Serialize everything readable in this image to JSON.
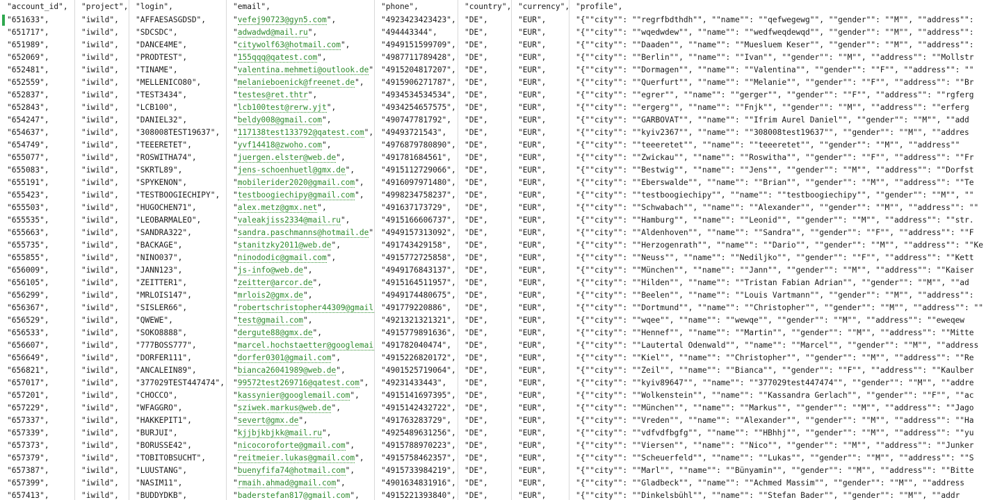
{
  "header": [
    "\"account_id\",",
    "\"project\",",
    "\"login\",",
    "\"email\",",
    "\"phone\",",
    "\"country\",",
    "\"currency\",",
    "\"profile\","
  ],
  "rows": [
    [
      "\"651633\",",
      "\"iwild\",",
      "\"AFFAESASGDSD\",",
      "vefej90723@gyn5.com",
      "\"4923423423423\",",
      "\"DE\",",
      "\"EUR\",",
      "\"{\"\"city\"\": \"\"regrfbdthdh\"\", \"\"name\"\": \"\"qefwegewg\"\", \"\"gender\"\": \"\"M\"\", \"\"address\"\":"
    ],
    [
      "\"651717\",",
      "\"iwild\",",
      "\"SDCSDC\",",
      "adwadwd@mail.ru",
      "\"494443344\",",
      "\"DE\",",
      "\"EUR\",",
      "\"{\"\"city\"\": \"\"wqedwdew\"\", \"\"name\"\": \"\"wedfweqdewqd\"\", \"\"gender\"\": \"\"M\"\", \"\"address\"\":"
    ],
    [
      "\"651989\",",
      "\"iwild\",",
      "\"DANCE4ME\",",
      "citywolf63@hotmail.com",
      "\"4949151599709\",",
      "\"DE\",",
      "\"EUR\",",
      "\"{\"\"city\"\": \"\"Daaden\"\", \"\"name\"\": \"\"Muesluem Keser\"\", \"\"gender\"\": \"\"M\"\", \"\"address\"\":"
    ],
    [
      "\"652069\",",
      "\"iwild\",",
      "\"PRODTEST\",",
      "155qqq@qatest.com",
      "\"4987711789428\",",
      "\"DE\",",
      "\"EUR\",",
      "\"{\"\"city\"\": \"\"Berlin\"\", \"\"name\"\": \"\"Ivan\"\", \"\"gender\"\": \"\"M\"\", \"\"address\"\": \"\"Mollstr"
    ],
    [
      "\"652481\",",
      "\"iwild\",",
      "\"TINAME\",",
      "valentina.mehmeti@outlook.de",
      "\"4915204817207\",",
      "\"DE\",",
      "\"EUR\",",
      "\"{\"\"city\"\": \"\"Dormagen\"\", \"\"name\"\": \"\"Valentina\"\", \"\"gender\"\": \"\"F\"\", \"\"address\"\": \"\""
    ],
    [
      "\"652559\",",
      "\"iwild\",",
      "\"MELLENICO80\",",
      "melanieboenick@freenet.de",
      "\"4915906271787\",",
      "\"DE\",",
      "\"EUR\",",
      "\"{\"\"city\"\": \"\"Querfurt\"\", \"\"name\"\": \"\"Melanie\"\", \"\"gender\"\": \"\"F\"\", \"\"address\"\": \"\"Br"
    ],
    [
      "\"652837\",",
      "\"iwild\",",
      "\"TEST3434\",",
      "testes@ret.thtr",
      "\"4934534534534\",",
      "\"DE\",",
      "\"EUR\",",
      "\"{\"\"city\"\": \"\"egrer\"\", \"\"name\"\": \"\"gerger\"\", \"\"gender\"\": \"\"F\"\", \"\"address\"\": \"\"rgferg"
    ],
    [
      "\"652843\",",
      "\"iwild\",",
      "\"LCB100\",",
      "lcb100test@rerw.yjt",
      "\"4934254657575\",",
      "\"DE\",",
      "\"EUR\",",
      "\"{\"\"city\"\": \"\"ergerg\"\", \"\"name\"\": \"\"Fnjk\"\", \"\"gender\"\": \"\"M\"\", \"\"address\"\": \"\"erferg"
    ],
    [
      "\"654247\",",
      "\"iwild\",",
      "\"DANIEL32\",",
      "beldy008@gmail.com",
      "\"490747781792\",",
      "\"DE\",",
      "\"EUR\",",
      "\"{\"\"city\"\": \"\"GARBOVAT\"\", \"\"name\"\": \"\"Ifrim Aurel Daniel\"\", \"\"gender\"\": \"\"M\"\", \"\"add"
    ],
    [
      "\"654637\",",
      "\"iwild\",",
      "\"308008TEST19637\",",
      "117138test133792@qatest.com",
      "\"49493721543\",",
      "\"DE\",",
      "\"EUR\",",
      "\"{\"\"city\"\": \"\"kyiv2367\"\", \"\"name\"\": \"\"308008test19637\"\", \"\"gender\"\": \"\"M\"\", \"\"addres"
    ],
    [
      "\"654749\",",
      "\"iwild\",",
      "\"TEEERETET\",",
      "yvf14418@zwoho.com",
      "\"4976879780890\",",
      "\"DE\",",
      "\"EUR\",",
      "\"{\"\"city\"\": \"\"teeeretet\"\", \"\"name\"\": \"\"teeeretet\"\", \"\"gender\"\": \"\"M\"\", \"\"address\"\""
    ],
    [
      "\"655077\",",
      "\"iwild\",",
      "\"ROSWITHA74\",",
      "juergen.elster@web.de",
      "\"491781684561\",",
      "\"DE\",",
      "\"EUR\",",
      "\"{\"\"city\"\": \"\"Zwickau\"\", \"\"name\"\": \"\"Roswitha\"\", \"\"gender\"\": \"\"F\"\", \"\"address\"\": \"\"Fr"
    ],
    [
      "\"655083\",",
      "\"iwild\",",
      "\"SKRTL89\",",
      "jens-schoenhuetl@gmx.de",
      "\"4915112729066\",",
      "\"DE\",",
      "\"EUR\",",
      "\"{\"\"city\"\": \"\"Bestwig\"\", \"\"name\"\": \"\"Jens\"\", \"\"gender\"\": \"\"M\"\", \"\"address\"\": \"\"Dorfst"
    ],
    [
      "\"655191\",",
      "\"iwild\",",
      "\"SPYKENON\",",
      "mobilerider2020@gmail.com",
      "\"4916097971480\",",
      "\"DE\",",
      "\"EUR\",",
      "\"{\"\"city\"\": \"\"Eberswalde\"\", \"\"name\"\": \"\"Brian\"\", \"\"gender\"\": \"\"M\"\", \"\"address\"\": \"\"Te"
    ],
    [
      "\"655423\",",
      "\"iwild\",",
      "\"TESTBOOGIECHIPY\",",
      "testboogiechipy@gmail.com",
      "\"4998234758237\",",
      "\"DE\",",
      "\"EUR\",",
      "\"{\"\"city\"\": \"\"testboogiechipy\"\", \"\"name\"\": \"\"testboogiechipy\"\", \"\"gender\"\": \"\"M\"\", \"\""
    ],
    [
      "\"655503\",",
      "\"iwild\",",
      "\"HUGOCHEN71\",",
      "alex.metz@gmx.net",
      "\"491637173729\",",
      "\"DE\",",
      "\"EUR\",",
      "\"{\"\"city\"\": \"\"Schwabach\"\", \"\"name\"\": \"\"Alexander\"\", \"\"gender\"\": \"\"M\"\", \"\"address\"\": \"\""
    ],
    [
      "\"655535\",",
      "\"iwild\",",
      "\"LEOBARMALEO\",",
      "valeakjiss2334@mail.ru",
      "\"4915166606737\",",
      "\"DE\",",
      "\"EUR\",",
      "\"{\"\"city\"\": \"\"Hamburg\"\", \"\"name\"\": \"\"Leonid\"\", \"\"gender\"\": \"\"M\"\", \"\"address\"\": \"\"str."
    ],
    [
      "\"655663\",",
      "\"iwild\",",
      "\"SANDRA322\",",
      "sandra.paschmanns@hotmail.de",
      "\"4949157313092\",",
      "\"DE\",",
      "\"EUR\",",
      "\"{\"\"city\"\": \"\"Aldenhoven\"\", \"\"name\"\": \"\"Sandra\"\", \"\"gender\"\": \"\"F\"\", \"\"address\"\": \"\"F"
    ],
    [
      "\"655735\",",
      "\"iwild\",",
      "\"BACKAGE\",",
      "stanitzky2011@web.de",
      "\"491743429158\",",
      "\"DE\",",
      "\"EUR\",",
      "\"{\"\"city\"\": \"\"Herzogenrath\"\", \"\"name\"\": \"\"Dario\"\", \"\"gender\"\": \"\"M\"\", \"\"address\"\": \"\"Ke"
    ],
    [
      "\"655855\",",
      "\"iwild\",",
      "\"NINO037\",",
      "ninododic@gmail.com",
      "\"4915772725858\",",
      "\"DE\",",
      "\"EUR\",",
      "\"{\"\"city\"\": \"\"Neuss\"\", \"\"name\"\": \"\"Nediljko\"\", \"\"gender\"\": \"\"F\"\", \"\"address\"\": \"\"Kett"
    ],
    [
      "\"656009\",",
      "\"iwild\",",
      "\"JANN123\",",
      "js-info@web.de",
      "\"4949176843137\",",
      "\"DE\",",
      "\"EUR\",",
      "\"{\"\"city\"\": \"\"München\"\", \"\"name\"\": \"\"Jann\"\", \"\"gender\"\": \"\"M\"\", \"\"address\"\": \"\"Kaiser"
    ],
    [
      "\"656105\",",
      "\"iwild\",",
      "\"ZEITTER1\",",
      "zeitter@arcor.de",
      "\"4915164511957\",",
      "\"DE\",",
      "\"EUR\",",
      "\"{\"\"city\"\": \"\"Hilden\"\", \"\"name\"\": \"\"Tristan Fabian Adrian\"\", \"\"gender\"\": \"\"M\"\", \"\"ad"
    ],
    [
      "\"656299\",",
      "\"iwild\",",
      "\"MRLOIS147\",",
      "mrlois2@gmx.de",
      "\"4949174480675\",",
      "\"DE\",",
      "\"EUR\",",
      "\"{\"\"city\"\": \"\"Beelen\"\", \"\"name\"\": \"\"Louis Vartmann\"\", \"\"gender\"\": \"\"M\"\", \"\"address\"\":"
    ],
    [
      "\"656367\",",
      "\"iwild\",",
      "\"SISLER66\",",
      "robertschristopher44309@gmail.",
      "\"491779220886\",",
      "\"DE\",",
      "\"EUR\",",
      "\"{\"\"city\"\": \"\"Dortmund\"\", \"\"name\"\": \"\"Christopher\"\", \"\"gender\"\": \"\"M\"\", \"\"address\"\": \"\""
    ],
    [
      "\"656529\",",
      "\"iwild\",",
      "\"QWEWE\",",
      "test@gmail.com",
      "\"4921321321321\",",
      "\"DE\",",
      "\"EUR\",",
      "\"{\"\"city\"\": \"\"wqee\"\", \"\"name\"\": \"\"wewqe\"\", \"\"gender\"\": \"\"M\"\", \"\"address\"\": \"\"eweqew"
    ],
    [
      "\"656533\",",
      "\"iwild\",",
      "\"SOKO8888\",",
      "dergute88@gmx.de",
      "\"4915779891636\",",
      "\"DE\",",
      "\"EUR\",",
      "\"{\"\"city\"\": \"\"Hennef\"\", \"\"name\"\": \"\"Martin\"\", \"\"gender\"\": \"\"M\"\", \"\"address\"\": \"\"Mitte"
    ],
    [
      "\"656607\",",
      "\"iwild\",",
      "\"777BOSS777\",",
      "marcel.hochstaetter@googlemail",
      "\"491782040474\",",
      "\"DE\",",
      "\"EUR\",",
      "\"{\"\"city\"\": \"\"Lautertal Odenwald\"\", \"\"name\"\": \"\"Marcel\"\", \"\"gender\"\": \"\"M\"\", \"\"address"
    ],
    [
      "\"656649\",",
      "\"iwild\",",
      "\"DORFER111\",",
      "dorfer0301@gmail.com",
      "\"4915226820172\",",
      "\"DE\",",
      "\"EUR\",",
      "\"{\"\"city\"\": \"\"Kiel\"\", \"\"name\"\": \"\"Christopher\"\", \"\"gender\"\": \"\"M\"\", \"\"address\"\": \"\"Re"
    ],
    [
      "\"656821\",",
      "\"iwild\",",
      "\"ANCALEIN89\",",
      "bianca26041989@web.de",
      "\"4901525719064\",",
      "\"DE\",",
      "\"EUR\",",
      "\"{\"\"city\"\": \"\"Zeil\"\", \"\"name\"\": \"\"Bianca\"\", \"\"gender\"\": \"\"F\"\", \"\"address\"\": \"\"Kaulber"
    ],
    [
      "\"657017\",",
      "\"iwild\",",
      "\"377029TEST447474\",",
      "99572test269716@qatest.com",
      "\"49231433443\",",
      "\"DE\",",
      "\"EUR\",",
      "\"{\"\"city\"\": \"\"kyiv89647\"\", \"\"name\"\": \"\"377029test447474\"\", \"\"gender\"\": \"\"M\"\", \"\"addre"
    ],
    [
      "\"657201\",",
      "\"iwild\",",
      "\"CHOCCO\",",
      "kassynier@googlemail.com",
      "\"4915141697395\",",
      "\"DE\",",
      "\"EUR\",",
      "\"{\"\"city\"\": \"\"Wolkenstein\"\", \"\"name\"\": \"\"Kassandra Gerlach\"\", \"\"gender\"\": \"\"F\"\", \"\"ac"
    ],
    [
      "\"657229\",",
      "\"iwild\",",
      "\"WFAGGRO\",",
      "sziwek.markus@web.de",
      "\"4915142432722\",",
      "\"DE\",",
      "\"EUR\",",
      "\"{\"\"city\"\": \"\"München\"\", \"\"name\"\": \"\"Markus\"\", \"\"gender\"\": \"\"M\"\", \"\"address\"\": \"\"Jago"
    ],
    [
      "\"657337\",",
      "\"iwild\",",
      "\"HAKKEPIT1\",",
      "severt@gmx.de",
      "\"491763283729\",",
      "\"DE\",",
      "\"EUR\",",
      "\"{\"\"city\"\": \"\"Vreden\"\", \"\"name\"\": \"\"Alexander\"\", \"\"gender\"\": \"\"M\"\", \"\"address\"\": \"\"Ha"
    ],
    [
      "\"657339\",",
      "\"iwild\",",
      "\"BURJUI\",",
      "kjjbjkbjkk@mail.ru",
      "\"4925489631256\",",
      "\"DE\",",
      "\"EUR\",",
      "\"{\"\"city\"\": \"\"vdfvdfbgfg\"\", \"\"name\"\": \"\"HBhhj\"\", \"\"gender\"\": \"\"M\"\", \"\"address\"\": \"\"yu"
    ],
    [
      "\"657373\",",
      "\"iwild\",",
      "\"BORUSSE42\",",
      "nicocoroforte@gmail.com",
      "\"4915788970223\",",
      "\"DE\",",
      "\"EUR\",",
      "\"{\"\"city\"\": \"\"Viersen\"\", \"\"name\"\": \"\"Nico\"\", \"\"gender\"\": \"\"M\"\", \"\"address\"\": \"\"Junker"
    ],
    [
      "\"657379\",",
      "\"iwild\",",
      "\"TOBITOBSUCHT\",",
      "reitmeier.lukas@gmail.com",
      "\"4915758462357\",",
      "\"DE\",",
      "\"EUR\",",
      "\"{\"\"city\"\": \"\"Scheuerfeld\"\", \"\"name\"\": \"\"Lukas\"\", \"\"gender\"\": \"\"M\"\", \"\"address\"\": \"\"S"
    ],
    [
      "\"657387\",",
      "\"iwild\",",
      "\"LUUSTANG\",",
      "buenyfifa74@hotmail.com",
      "\"4915733984219\",",
      "\"DE\",",
      "\"EUR\",",
      "\"{\"\"city\"\": \"\"Marl\"\", \"\"name\"\": \"\"Bünyamin\"\", \"\"gender\"\": \"\"M\"\", \"\"address\"\": \"\"Bitte"
    ],
    [
      "\"657399\",",
      "\"iwild\",",
      "\"NASIM11\",",
      "rmaih.ahmad@gmail.com",
      "\"4901634831916\",",
      "\"DE\",",
      "\"EUR\",",
      "\"{\"\"city\"\": \"\"Gladbeck\"\", \"\"name\"\": \"\"Achmed Massim\"\", \"\"gender\"\": \"\"M\"\", \"\"address"
    ],
    [
      "\"657413\",",
      "\"iwild\",",
      "\"BUDDYDKB\",",
      "baderstefan817@gmail.com",
      "\"4915221393840\",",
      "\"DE\",",
      "\"EUR\",",
      "\"{\"\"city\"\": \"\"Dinkelsbühl\"\", \"\"name\"\": \"\"Stefan Bader\"\", \"\"gender\"\": \"\"M\"\", \"\"addr"
    ]
  ],
  "colors": {
    "email_link": "#2e8b2e",
    "cursor_marker": "#2fa84f",
    "grid_line": "#d8d8d8"
  }
}
